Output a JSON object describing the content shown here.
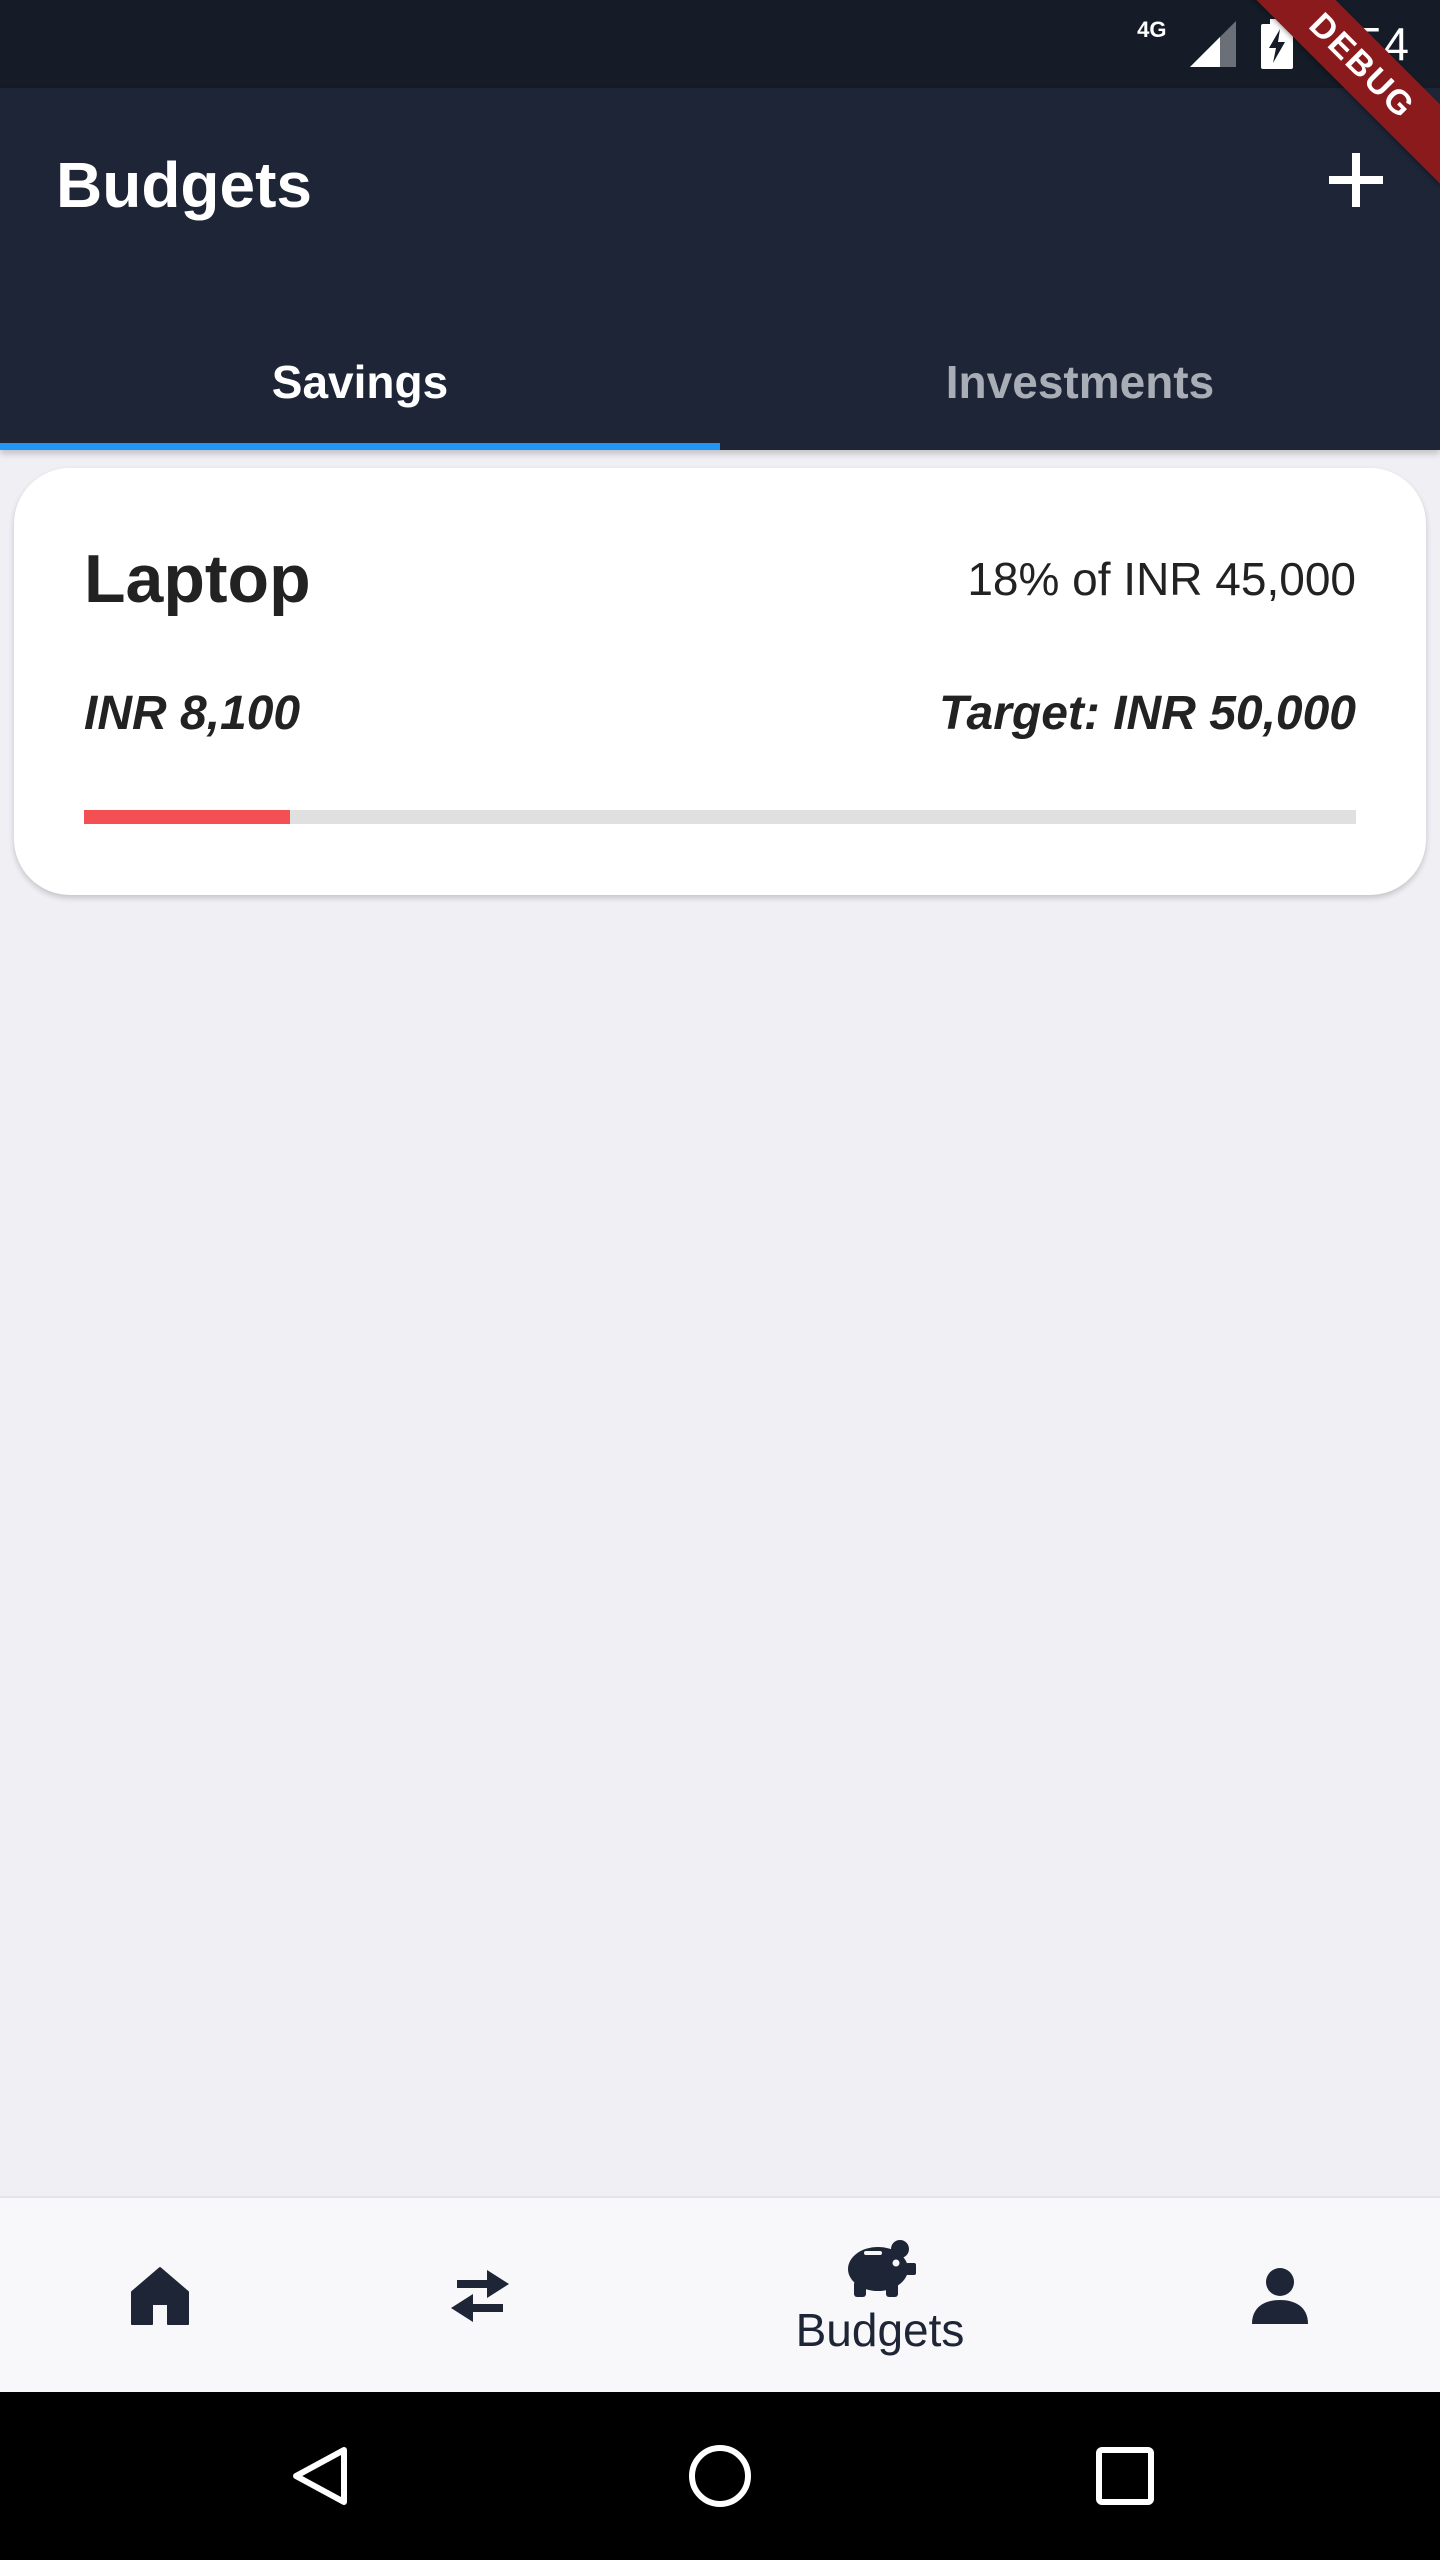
{
  "status_bar": {
    "network": "4G",
    "time": "6:54",
    "debug_label": "DEBUG"
  },
  "app_bar": {
    "title": "Budgets",
    "add_icon": "plus-icon"
  },
  "tabs": [
    {
      "label": "Savings",
      "active": true
    },
    {
      "label": "Investments",
      "active": false
    }
  ],
  "budget_card": {
    "title": "Laptop",
    "percent_text": "18% of INR 45,000",
    "amount": "INR 8,100",
    "target": "Target: INR 50,000",
    "progress_fraction": 0.162,
    "progress_color": "#f44f52"
  },
  "bottom_nav": {
    "items": [
      {
        "icon": "home-icon",
        "label": ""
      },
      {
        "icon": "swap-arrows-icon",
        "label": ""
      },
      {
        "icon": "piggy-bank-icon",
        "label": "Budgets",
        "active": true
      },
      {
        "icon": "person-icon",
        "label": ""
      }
    ]
  },
  "system_nav": {
    "items": [
      "back-icon",
      "home-circle-icon",
      "recents-icon"
    ]
  },
  "colors": {
    "app_bar": "#1e2536",
    "status_bar": "#151b27",
    "tab_indicator": "#2196f3",
    "background": "#efeff4"
  }
}
